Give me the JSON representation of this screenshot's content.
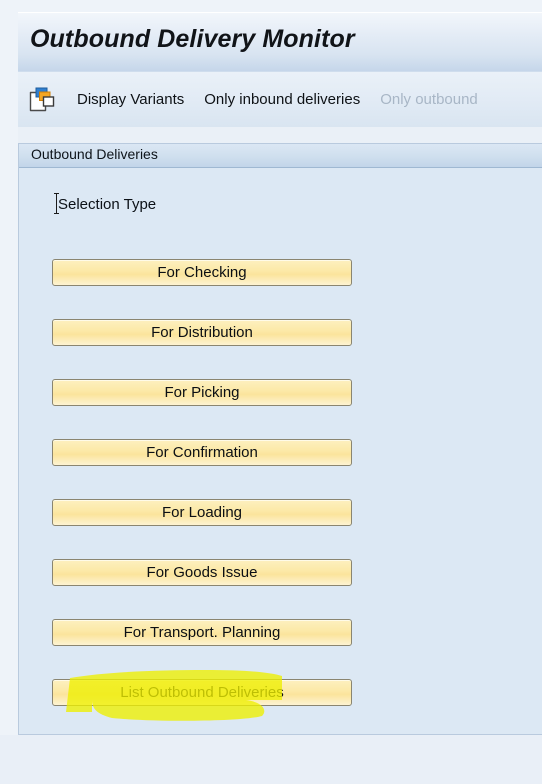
{
  "window": {
    "title": "Outbound Delivery Monitor"
  },
  "toolbar": {
    "variants_icon": "display-variants-icon",
    "items": [
      {
        "label": "Display Variants",
        "disabled": false
      },
      {
        "label": "Only inbound deliveries",
        "disabled": false
      },
      {
        "label": "Only outbound",
        "disabled": true
      }
    ]
  },
  "panel": {
    "tab_label": "Outbound Deliveries",
    "section_label": "Selection Type",
    "buttons": [
      {
        "label": "For Checking"
      },
      {
        "label": "For Distribution"
      },
      {
        "label": "For Picking"
      },
      {
        "label": "For Confirmation"
      },
      {
        "label": "For Loading"
      },
      {
        "label": "For Goods Issue"
      },
      {
        "label": "For Transport. Planning"
      }
    ],
    "primary_button": {
      "label": "List Outbound Deliveries"
    }
  },
  "annotation": {
    "type": "highlighter-marker",
    "target": "List Outbound Deliveries",
    "color": "#eff000"
  },
  "colors": {
    "title_bar_start": "#f2f6fb",
    "title_bar_end": "#c5d6ea",
    "toolbar_bg": "#e2ebf5",
    "panel_bg": "#dce8f4",
    "panel_border": "#b9cade",
    "button_fill": "#fce9a8",
    "button_border": "#8a8570",
    "disabled_text": "#a8b6c6",
    "text": "#0c1117",
    "highlighter": "#eff000"
  }
}
